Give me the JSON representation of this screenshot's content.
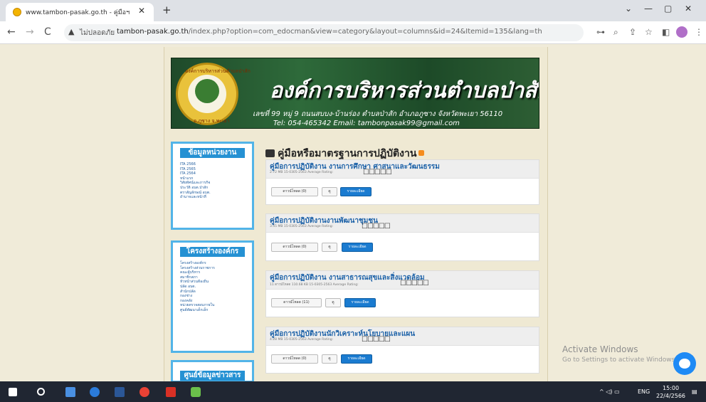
{
  "browser": {
    "tab_title": "www.tambon-pasak.go.th - คู่มือฯ",
    "tab_close": "✕",
    "new_tab": "+",
    "win_min": "—",
    "win_restore": "▢",
    "win_close": "✕",
    "win_dropdown": "⌄",
    "back": "←",
    "forward": "→",
    "reload": "C",
    "security_label": "ไม่ปลอดภัย",
    "url_host": "tambon-pasak.go.th",
    "url_path": "/index.php?option=com_edocman&view=category&layout=columns&id=24&Itemid=135&lang=th",
    "toolbar_icons": [
      "key-icon",
      "zoom-icon",
      "share-icon",
      "star-icon",
      "sidepanel-icon",
      "profile-avatar",
      "menu-icon"
    ]
  },
  "header": {
    "org_name": "องค์การบริหารส่วนตำบลป่าสัก",
    "address": "เลขที่ 99 หมู่ 9 ถนนสบบง-บ้านร่อง ตำบลป่าสัก อำเภอภูซาง จังหวัดพะเยา 56110",
    "contact": "Tel: 054-465342     Email: tambonpasak99@gmail.com",
    "seal_top": "องค์การบริหารส่วนตำบลป่าสัก",
    "seal_bottom": "อ.ภูซาง จ.พะเยา"
  },
  "sidebar": {
    "box1": {
      "heading": "ข้อมูลหน่วยงาน",
      "links": [
        "ITA 2566",
        "ITA 2565",
        "ITA 2564",
        "หน้าแรก",
        "วิสัยทัศน์และภารกิจ",
        "ประวัติ อบต.ป่าสัก",
        "ตราสัญลักษณ์ อบต.",
        "อำนาจและหน้าที่"
      ]
    },
    "box2": {
      "heading": "โครงสร้างองค์กร",
      "links": [
        "โครงสร้างองค์กร",
        "โครงสร้างส่วนราชการ",
        "คณะผู้บริหาร",
        "สมาชิกสภา",
        "หัวหน้าส่วนท้องถิ่น",
        "ปลัด อบต.",
        "สำนักปลัด",
        "กองช่าง",
        "กองคลัง",
        "หน่วยตรวจสอบภายใน",
        "ศูนย์พัฒนาเด็กเล็ก"
      ]
    },
    "box3": {
      "heading": "ศูนย์ข้อมูลข่าวสาร"
    }
  },
  "main": {
    "category_title": "คู่มือหรือมาตรฐานการปฏิบัติงาน",
    "documents": [
      {
        "title": "คู่มือการปฏิบัติงาน งานการศึกษา ศาสนาและวัฒนธรรม",
        "meta": "2.72 MB   15-0305-2563   Average Rating:",
        "rating": "☐☐☐☐☐",
        "download": "ดาวน์โหลด (0)",
        "view": "ดู",
        "detail": "รายละเอียด"
      },
      {
        "title": "คู่มือการปฏิบัติงานงานพัฒนาชุมชน",
        "meta": "3.55 MB   15-0305-2563   Average Rating:",
        "rating": "☐☐☐☐☐",
        "download": "ดาวน์โหลด (0)",
        "view": "ดู",
        "detail": "รายละเอียด"
      },
      {
        "title": "คู่มือการปฏิบัติงาน งานสาธารณสุขและสิ่งแวดล้อม",
        "meta": "11 ดาวน์โหลด   110.68 KB   15-0305-2563   Average Rating:",
        "rating": "☐☐☐☐☐",
        "download": "ดาวน์โหลด (11)",
        "view": "ดู",
        "detail": "รายละเอียด"
      },
      {
        "title": "คู่มือการปฏิบัติงานนักวิเคราะห์นโยบายและแผน",
        "meta": "4.28 MB   15-0305-2563   Average Rating:",
        "rating": "☐☐☐☐☐",
        "download": "ดาวน์โหลด (0)",
        "view": "ดู",
        "detail": "รายละเอียด"
      }
    ]
  },
  "overlay": {
    "activate_title": "Activate Windows",
    "activate_sub": "Go to Settings to activate Windows."
  },
  "taskbar": {
    "language": "ENG",
    "time": "15:00",
    "date": "22/4/2566",
    "tray_glyphs": "^  ◁)  ▭"
  }
}
